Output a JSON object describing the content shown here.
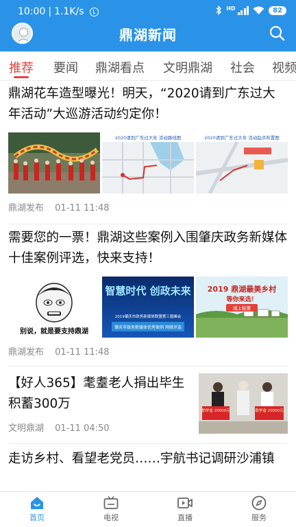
{
  "status": {
    "time": "10:00",
    "speed": "1.1K/s",
    "network": "HD",
    "battery": "82"
  },
  "header": {
    "title": "鼎湖新闻",
    "avatar_icon": "user-avatar",
    "search_icon": "search-icon"
  },
  "tabs": [
    {
      "label": "推荐",
      "active": true
    },
    {
      "label": "要闻"
    },
    {
      "label": "鼎湖看点"
    },
    {
      "label": "文明鼎湖"
    },
    {
      "label": "社会"
    },
    {
      "label": "视频"
    }
  ],
  "articles": [
    {
      "title": "鼎湖花车造型曝光！明天，“2020请到广东过大年活动”大巡游活动约定你！",
      "thumbs": [
        {
          "caption": ""
        },
        {
          "caption": "2020请到广东过大年 活动路线图"
        },
        {
          "caption": "2020请到广东过大年 活动起点布置图"
        }
      ],
      "source": "鼎湖发布",
      "time": "01-11 11:48"
    },
    {
      "title": "需要您的一票！鼎湖这些案例入围肇庆政务新媒体十佳案例评选，快来支持！",
      "thumbs": [
        {
          "caption": "别说，就是要支持鼎湖"
        },
        {
          "caption": "智慧时代 创政未来",
          "sub": "2019肇庆市政务新媒体联盟第三届峰会",
          "sub2": "肇庆市政务新媒体优秀案例 网络评选"
        },
        {
          "caption": "2019 鼎湖最美乡村",
          "sub": "等你来选！",
          "sub2": "线上投票"
        }
      ],
      "source": "鼎湖发布",
      "time": "01-11 11:48"
    },
    {
      "title": "【好人365】耄耋老人捐出毕生积蓄300万",
      "thumb_labels": [
        "助学金 20000元",
        "助学金 20000元"
      ],
      "source": "文明鼎湖",
      "time": "01-11 04:50"
    },
    {
      "title": "走访乡村、看望老党员……宇航书记调研沙浦镇"
    }
  ],
  "bottom_nav": [
    {
      "label": "首页",
      "icon": "home-icon",
      "active": true
    },
    {
      "label": "电视",
      "icon": "tv-icon"
    },
    {
      "label": "直播",
      "icon": "live-video-icon"
    },
    {
      "label": "服务",
      "icon": "compass-icon"
    }
  ],
  "colors": {
    "brand": "#2a93e8",
    "accent": "#e64340"
  }
}
